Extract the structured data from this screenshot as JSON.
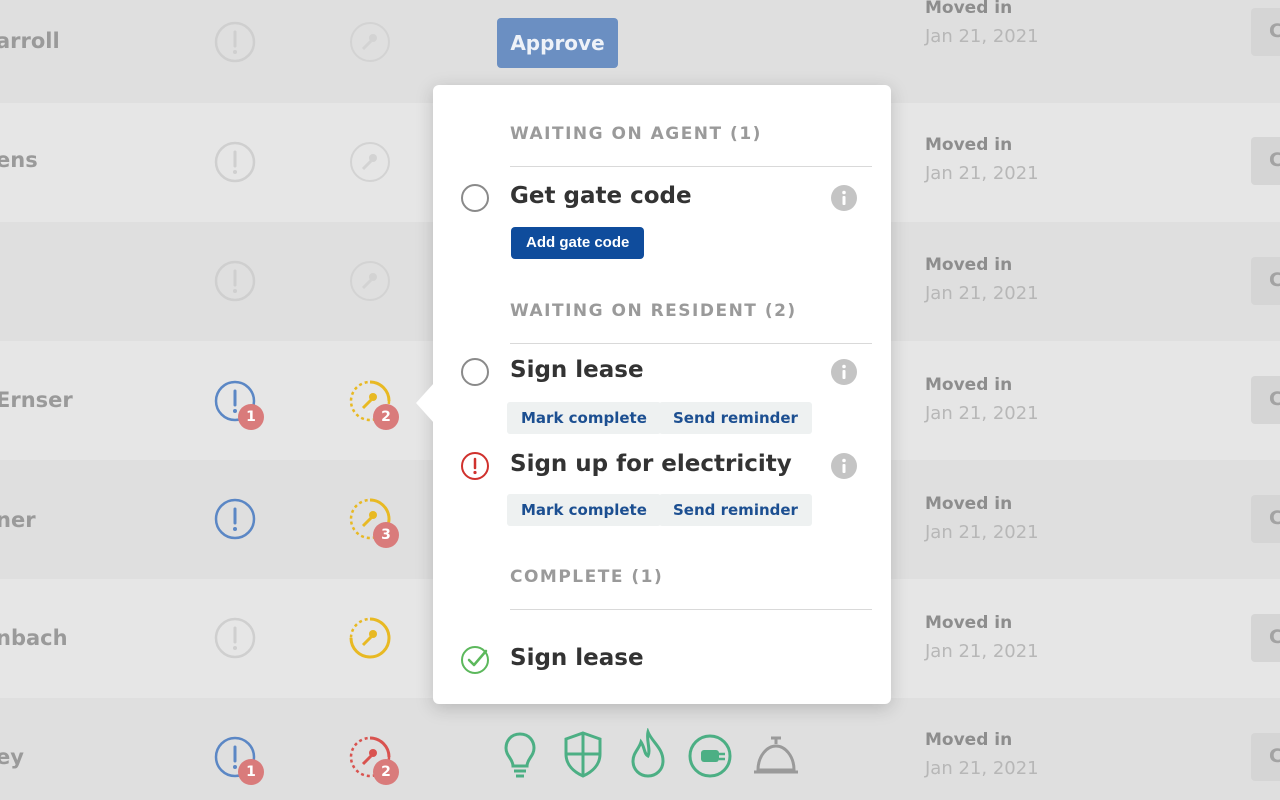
{
  "rows": [
    {
      "name": "arroll",
      "moved_label": "Moved in",
      "moved_date": "Jan 21, 2021",
      "right_btn": "C",
      "action": "Approve"
    },
    {
      "name": "ens",
      "moved_label": "Moved in",
      "moved_date": "Jan 21, 2021",
      "right_btn": "C"
    },
    {
      "name": "",
      "moved_label": "Moved in",
      "moved_date": "Jan 21, 2021",
      "right_btn": "C"
    },
    {
      "name": "Ernser",
      "moved_label": "Moved in",
      "moved_date": "Jan 21, 2021",
      "right_btn": "C",
      "alert_badge": "1",
      "key_badge": "2"
    },
    {
      "name": "ner",
      "moved_label": "Moved in",
      "moved_date": "Jan 21, 2021",
      "right_btn": "C",
      "key_badge": "3"
    },
    {
      "name": "nbach",
      "moved_label": "Moved in",
      "moved_date": "Jan 21, 2021",
      "right_btn": "C"
    },
    {
      "name": "ey",
      "moved_label": "Moved in",
      "moved_date": "Jan 21, 2021",
      "right_btn": "C",
      "alert_badge": "1",
      "key_badge": "2"
    }
  ],
  "utility_icons": [
    "lightbulb-icon",
    "shield-icon",
    "flame-icon",
    "plug-icon",
    "service-bell-icon"
  ],
  "popover": {
    "sections": [
      {
        "title": "WAITING ON AGENT (1)",
        "tasks": [
          {
            "title": "Get gate code",
            "status": "open",
            "actions": [
              "Add gate code"
            ]
          }
        ]
      },
      {
        "title": "WAITING ON RESIDENT (2)",
        "tasks": [
          {
            "title": "Sign lease",
            "status": "open",
            "actions": [
              "Mark complete",
              "Send reminder"
            ]
          },
          {
            "title": "Sign up for electricity",
            "status": "overdue",
            "actions": [
              "Mark complete",
              "Send reminder"
            ]
          }
        ]
      },
      {
        "title": "COMPLETE (1)",
        "tasks": [
          {
            "title": "Sign lease",
            "status": "complete"
          }
        ]
      }
    ]
  },
  "colors": {
    "primary": "#0f4c9c",
    "alert_blue": "#5b87c5",
    "key_yellow": "#e8b923",
    "badge_red": "#d9534f",
    "overdue_red": "#d0312d",
    "complete_green": "#5cb85c",
    "utility_green": "#4caf84"
  }
}
